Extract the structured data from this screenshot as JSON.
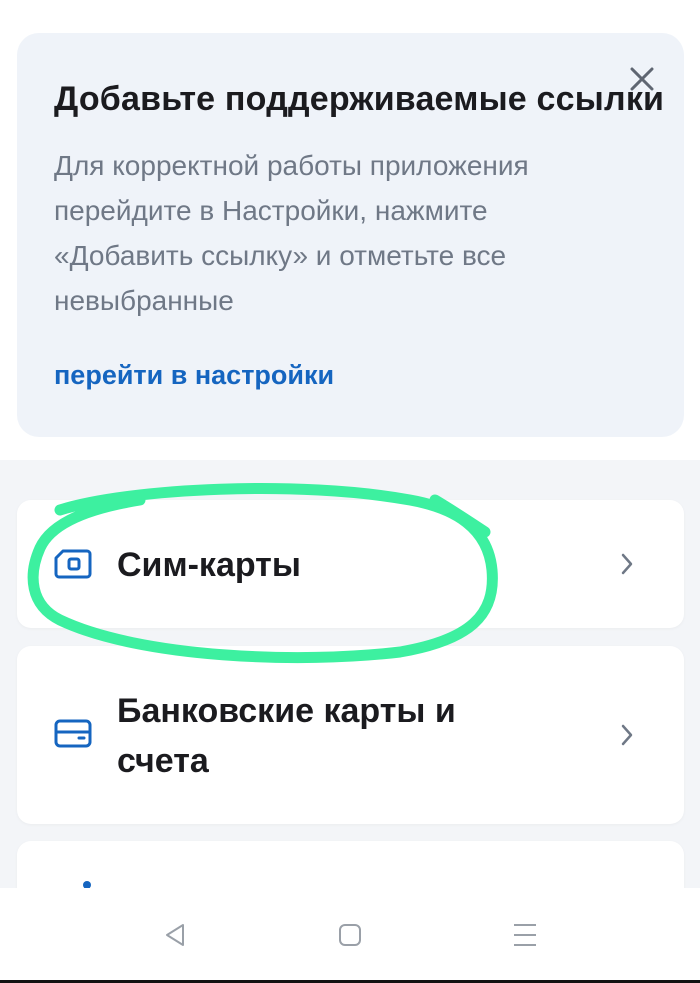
{
  "banner": {
    "title": "Добавьте поддерживаемые ссылки",
    "text_lines": [
      "Для корректной работы приложения",
      "перейдите в Настройки, нажмите",
      "«Добавить ссылку» и отметьте все",
      "невыбранные"
    ],
    "link_label": "перейти в настройки",
    "close_icon": "close-icon"
  },
  "menu": {
    "items": [
      {
        "label": "Сим-карты",
        "icon": "sim-card-icon"
      },
      {
        "label": "Банковские карты и счета",
        "label_lines": [
          "Банковские карты и",
          "счета"
        ],
        "icon": "bank-card-icon"
      }
    ]
  },
  "annotation": {
    "color": "#3df0a0",
    "meaning": "hand-drawn highlight around Сим-карты"
  },
  "nav": {
    "back": "back-triangle-icon",
    "home": "home-square-icon",
    "menu": "menu-lines-icon"
  },
  "colors": {
    "accent": "#1565c0",
    "banner_bg": "#eff3f9",
    "text_muted": "#6f7886"
  }
}
